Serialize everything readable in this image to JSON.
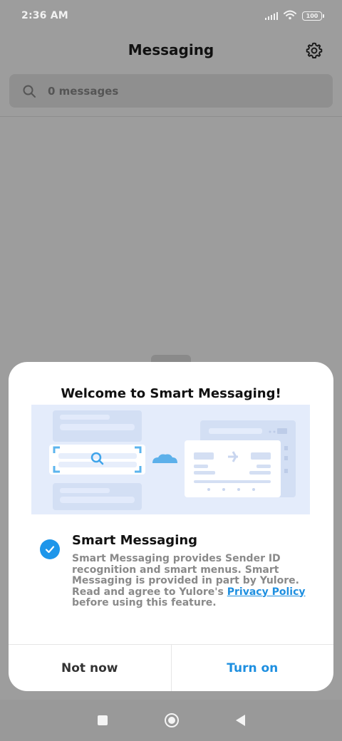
{
  "status_bar": {
    "time": "2:36 AM",
    "battery": "100",
    "icons": [
      "signal-icon",
      "wifi-icon",
      "battery-icon"
    ]
  },
  "header": {
    "title": "Messaging",
    "settings_icon": "gear-icon"
  },
  "search": {
    "text": "0 messages",
    "icon": "search-icon"
  },
  "dialog": {
    "title": "Welcome to Smart Messaging!",
    "option": {
      "checked": true,
      "title": "Smart Messaging",
      "description_before_link": "Smart Messaging provides Sender ID recognition and smart menus. Smart Messaging is provided in part by Yulore. Read and agree to Yulore's",
      "link_text": "Privacy Policy",
      "description_after_link": "before using this feature."
    },
    "buttons": {
      "cancel": "Not now",
      "confirm": "Turn on"
    }
  },
  "colors": {
    "accent": "#1e96ea",
    "link": "#1e8fe0",
    "scrim": "#9d9d9d"
  },
  "nav_bar": {
    "icons": [
      "recents-icon",
      "home-icon",
      "back-icon"
    ]
  }
}
